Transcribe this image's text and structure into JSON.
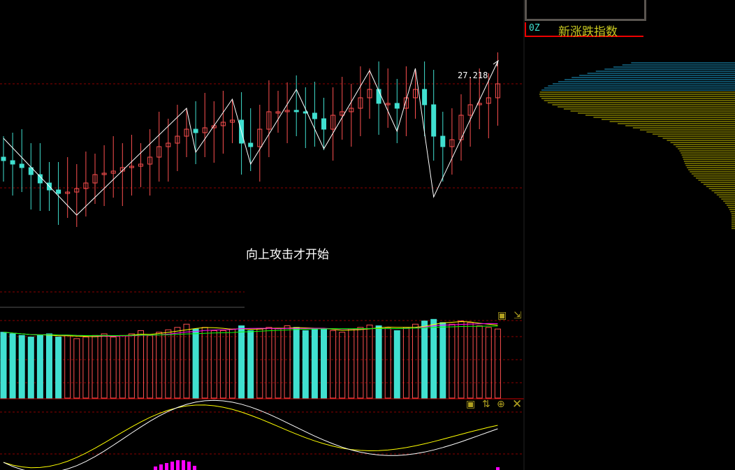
{
  "indicator": {
    "code": "0Z",
    "name": "新涨跌指数"
  },
  "annotation": "向上攻击才开始",
  "price_label": "27.218",
  "colors": {
    "up": "#ff5050",
    "down": "#40e0d0",
    "zigzag": "#ffffff",
    "grid": "#8b0000",
    "ma1": "#ffff00",
    "ma2": "#ff00ff",
    "ma3": "#00ff00"
  },
  "closes": [
    26.0,
    25.95,
    25.9,
    25.8,
    25.68,
    25.58,
    25.53,
    25.55,
    25.6,
    25.68,
    25.8,
    25.82,
    25.85,
    25.9,
    25.92,
    25.95,
    26.05,
    26.2,
    26.25,
    26.35,
    26.45,
    26.4,
    26.47,
    26.5,
    26.55,
    26.58,
    26.25,
    26.2,
    26.45,
    26.7,
    26.7,
    26.72,
    26.7,
    26.68,
    26.6,
    26.45,
    26.65,
    26.7,
    26.75,
    26.9,
    27.02,
    26.82,
    26.82,
    26.75,
    26.9,
    27.02,
    26.8,
    26.35,
    26.2,
    26.3,
    26.65,
    26.8,
    26.82,
    26.9,
    27.1
  ],
  "zigzag": [
    [
      0,
      26.32
    ],
    [
      8,
      25.22
    ],
    [
      20,
      26.75
    ],
    [
      21,
      26.12
    ],
    [
      25,
      26.88
    ],
    [
      27,
      25.95
    ],
    [
      32,
      27.02
    ],
    [
      35,
      26.17
    ],
    [
      40,
      27.29
    ],
    [
      43,
      26.42
    ],
    [
      45,
      27.32
    ],
    [
      47,
      25.48
    ],
    [
      54,
      27.42
    ]
  ],
  "volumes": [
    82,
    80,
    78,
    76,
    78,
    80,
    76,
    78,
    74,
    76,
    78,
    80,
    76,
    78,
    80,
    84,
    78,
    82,
    85,
    88,
    92,
    86,
    88,
    84,
    84,
    86,
    90,
    84,
    86,
    88,
    87,
    90,
    88,
    84,
    86,
    86,
    84,
    82,
    86,
    88,
    91,
    90,
    87,
    84,
    88,
    92,
    96,
    98,
    94,
    92,
    96,
    94,
    90,
    88,
    86
  ]
}
